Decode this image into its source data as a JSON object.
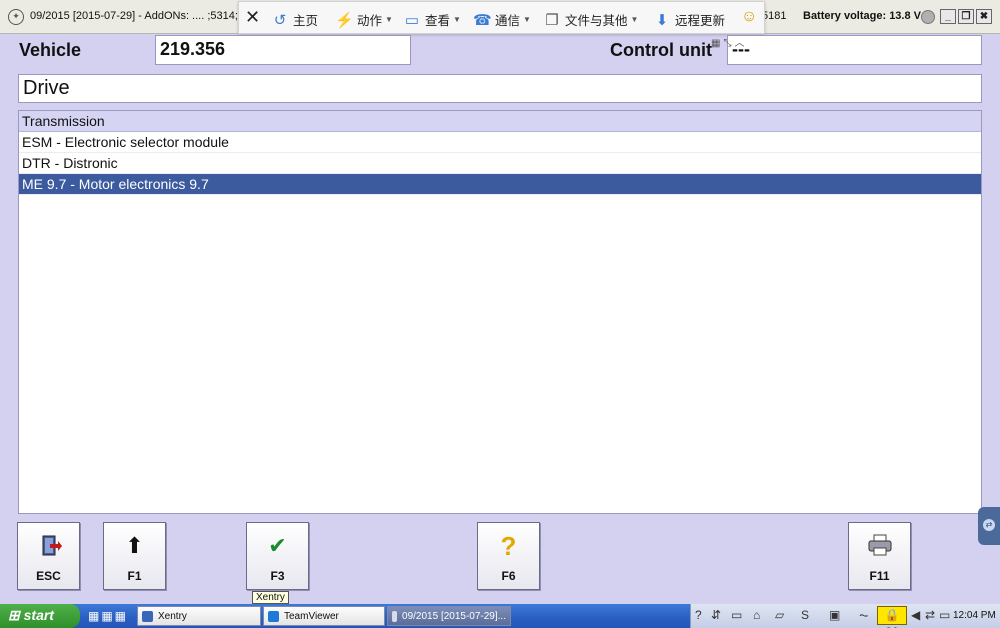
{
  "titlebar": {
    "title": "09/2015 [2015-07-29] - AddONs:  .... ;5314;53",
    "right_fragment": "5181",
    "battery": "Battery voltage: 13.8 V",
    "minimize": "_",
    "restore": "❐",
    "close": "✖"
  },
  "remote_toolbar": {
    "close_glyph": "✕",
    "items": [
      {
        "label": "主页",
        "icon": "home-icon",
        "glyph": "↺"
      },
      {
        "label": "动作",
        "icon": "lightning-icon",
        "glyph": "⚡"
      },
      {
        "label": "查看",
        "icon": "monitor-icon",
        "glyph": "▭"
      },
      {
        "label": "通信",
        "icon": "phone-icon",
        "glyph": "☎"
      },
      {
        "label": "文件与其他",
        "icon": "file-icon",
        "glyph": "❐"
      },
      {
        "label": "远程更新",
        "icon": "download-icon",
        "glyph": "⬇"
      }
    ],
    "emoji": "☺"
  },
  "header": {
    "vehicle_label": "Vehicle",
    "vehicle_value": "219.356",
    "control_unit_label": "Control unit",
    "control_unit_value": "---"
  },
  "section": {
    "title": "Drive"
  },
  "list": {
    "header": "Transmission",
    "items": [
      {
        "label": "ESM - Electronic selector module",
        "selected": false
      },
      {
        "label": "DTR - Distronic",
        "selected": false
      },
      {
        "label": "ME 9.7 - Motor electronics 9.7",
        "selected": true
      }
    ]
  },
  "function_keys": [
    {
      "label": "ESC",
      "icon": "exit-door-icon",
      "glyph": "⬅",
      "color": "#b01c1c"
    },
    {
      "label": "F1",
      "icon": "arrow-up-icon",
      "glyph": "⬆",
      "color": "#111111"
    },
    {
      "label": "F3",
      "icon": "checkmark-icon",
      "glyph": "✔",
      "color": "#1a8a2a"
    },
    {
      "label": "F6",
      "icon": "help-icon",
      "glyph": "?",
      "color": "#e0a800"
    },
    {
      "label": "F11",
      "icon": "printer-icon",
      "glyph": "⎙",
      "color": "#333333"
    }
  ],
  "tooltip": "Xentry",
  "taskbar": {
    "start": "start",
    "quicklaunch": "▦▦▦",
    "tasks": [
      {
        "label": "Xentry",
        "active": false
      },
      {
        "label": "TeamViewer",
        "active": false
      },
      {
        "label": "09/2015 [2015-07-29]...",
        "active": true
      }
    ],
    "tray_count": "21",
    "clock": "12:04 PM"
  },
  "colors": {
    "background": "#d4d0f0",
    "selection": "#3c5a9e",
    "list_header": "#d6d4f3"
  }
}
